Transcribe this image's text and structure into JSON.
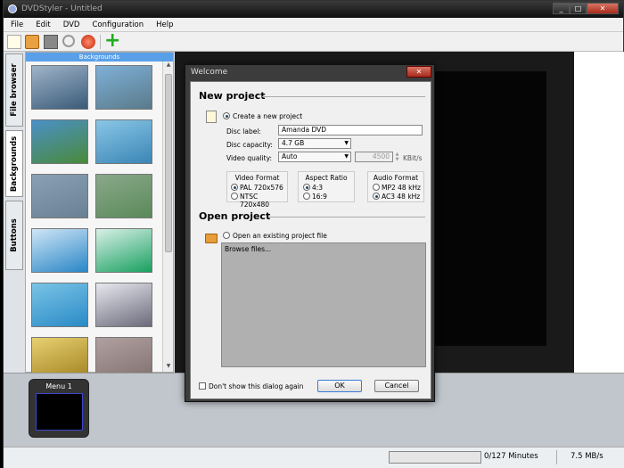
{
  "window": {
    "title": "DVDStyler - Untitled"
  },
  "menubar": {
    "items": [
      "File",
      "Edit",
      "DVD",
      "Configuration",
      "Help"
    ]
  },
  "lefttabs": {
    "file_browser": "File browser",
    "backgrounds": "Backgrounds",
    "buttons": "Buttons"
  },
  "bgpanel": {
    "header": "Backgrounds",
    "thumbs": [
      {
        "c1": "#9fb4c8",
        "c2": "#3a5a78"
      },
      {
        "c1": "#7fb0d8",
        "c2": "#5a7a8a"
      },
      {
        "c1": "#4a90c8",
        "c2": "#4a8a3a"
      },
      {
        "c1": "#8ac6e6",
        "c2": "#3a86b6"
      },
      {
        "c1": "#8aa0b4",
        "c2": "#6a8094"
      },
      {
        "c1": "#8aa88a",
        "c2": "#5a8a5a"
      },
      {
        "c1": "#cfe6f6",
        "c2": "#2a86c6"
      },
      {
        "c1": "#d8f0e8",
        "c2": "#1aa060"
      },
      {
        "c1": "#7ac4e6",
        "c2": "#2a8ac6"
      },
      {
        "c1": "#e8e8f0",
        "c2": "#6a6a7a"
      },
      {
        "c1": "#e8d070",
        "c2": "#a08020"
      },
      {
        "c1": "#b0a0a0",
        "c2": "#807070"
      }
    ]
  },
  "menustrip": {
    "thumb_label": "Menu 1"
  },
  "statusbar": {
    "minutes": "0/127 Minutes",
    "rate": "7.5 MB/s"
  },
  "dialog": {
    "title": "Welcome",
    "new_project": "New project",
    "create_label": "Create a new project",
    "disc_label_label": "Disc label:",
    "disc_label_value": "Amanda DVD",
    "disc_capacity_label": "Disc capacity:",
    "disc_capacity_value": "4.7 GB",
    "video_quality_label": "Video quality:",
    "video_quality_value": "Auto",
    "bitrate_value": "4500",
    "bitrate_unit": "KBit/s",
    "video_format": {
      "title": "Video Format",
      "opt1": "PAL 720x576",
      "opt2": "NTSC 720x480"
    },
    "aspect_ratio": {
      "title": "Aspect Ratio",
      "opt1": "4:3",
      "opt2": "16:9"
    },
    "audio_format": {
      "title": "Audio Format",
      "opt1": "MP2 48 kHz",
      "opt2": "AC3 48 kHz"
    },
    "open_project": "Open project",
    "open_existing_label": "Open an existing project file",
    "browse_text": "Browse files...",
    "dont_show": "Don't show this dialog again",
    "ok": "OK",
    "cancel": "Cancel"
  }
}
